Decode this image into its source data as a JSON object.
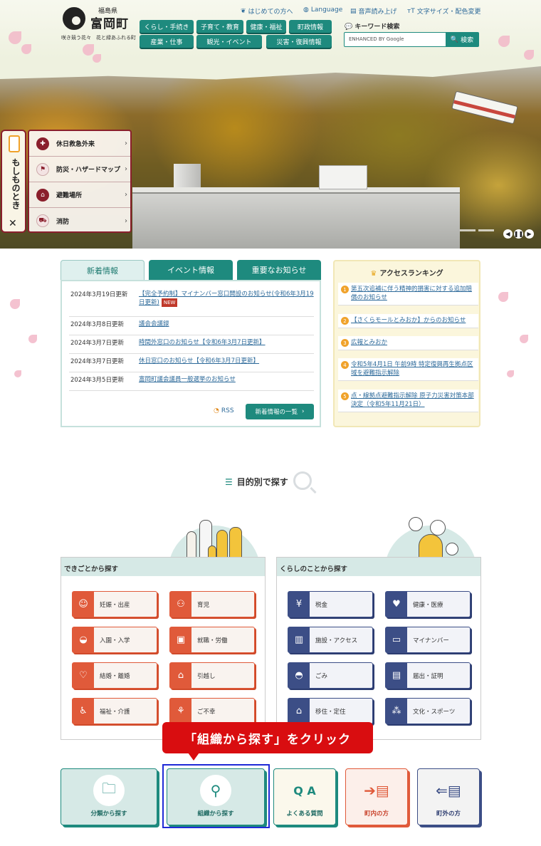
{
  "header": {
    "pref": "福島県",
    "town": "富岡町",
    "tagline": "咲き競う花々　花と緑あふれる町",
    "util": [
      {
        "label": "はじめての方へ",
        "icon": "leaf-icon"
      },
      {
        "label": "Language",
        "icon": "globe-icon"
      },
      {
        "label": "音声読み上げ",
        "icon": "speaker-icon"
      },
      {
        "label": "文字サイズ・配色変更",
        "icon": "text-size-icon"
      }
    ],
    "nav": [
      "くらし・手続き",
      "子育て・教育",
      "健康・福祉",
      "町政情報",
      "産業・仕事",
      "観光・イベント",
      "災害・復興情報"
    ],
    "keyword_label": "キーワード検索",
    "search_placeholder": "ENHANCED BY Google",
    "search_button": "検索"
  },
  "emergency": {
    "tab_label": "もしものとき",
    "close": "✕",
    "items": [
      "休日救急外来",
      "防災・ハザードマップ",
      "避難場所",
      "消防"
    ]
  },
  "news": {
    "tabs": [
      "新着情報",
      "イベント情報",
      "重要なお知らせ"
    ],
    "items": [
      {
        "date": "2024年3月19日更新",
        "text": "【完全予約制】マイナンバー窓口開設のお知らせ(令和6年3月19日更新)",
        "new": "NEW"
      },
      {
        "date": "2024年3月8日更新",
        "text": "議会会議録"
      },
      {
        "date": "2024年3月7日更新",
        "text": "時間外窓口のお知らせ【令和6年3月7日更新】"
      },
      {
        "date": "2024年3月7日更新",
        "text": "休日窓口のお知らせ【令和6年3月7日更新】"
      },
      {
        "date": "2024年3月5日更新",
        "text": "富岡町議会議員一般選挙のお知らせ"
      }
    ],
    "rss": "RSS",
    "more": "新着情報の一覧"
  },
  "ranking": {
    "title": "アクセスランキング",
    "items": [
      {
        "num": "1",
        "text": "第五次追補に伴う精神的損害に対する追加賠償のお知らせ"
      },
      {
        "num": "2",
        "text": "【さくらモールとみおか】からのお知らせ"
      },
      {
        "num": "3",
        "text": "広報とみおか"
      },
      {
        "num": "4",
        "text": "令和5年4月1日 午前9時 特定復興再生拠点区域を避難指示解除"
      },
      {
        "num": "5",
        "text": "点・線拠点避難指示解除 原子力災害対策本部決定（令和5年11月21日）"
      }
    ]
  },
  "purpose": {
    "title": "目的別で探す",
    "life_events": {
      "title": "できごとから探す",
      "items": [
        {
          "label": "妊娠・出産",
          "icon": "pregnancy-icon"
        },
        {
          "label": "育児",
          "icon": "stroller-icon"
        },
        {
          "label": "入園・入学",
          "icon": "school-hat-icon"
        },
        {
          "label": "就職・労働",
          "icon": "briefcase-icon"
        },
        {
          "label": "結婚・離婚",
          "icon": "heart-icon"
        },
        {
          "label": "引越し",
          "icon": "house-icon"
        },
        {
          "label": "福祉・介護",
          "icon": "care-icon"
        },
        {
          "label": "ご不幸",
          "icon": "memorial-icon"
        }
      ]
    },
    "living": {
      "title": "くらしのことから探す",
      "items": [
        {
          "label": "税金",
          "icon": "yen-icon"
        },
        {
          "label": "健康・医療",
          "icon": "heartbeat-icon"
        },
        {
          "label": "施設・アクセス",
          "icon": "train-icon"
        },
        {
          "label": "マイナンバー",
          "icon": "id-card-icon"
        },
        {
          "label": "ごみ",
          "icon": "garbage-bag-icon"
        },
        {
          "label": "届出・証明",
          "icon": "document-icon"
        },
        {
          "label": "移住・定住",
          "icon": "home-heart-icon"
        },
        {
          "label": "文化・スポーツ",
          "icon": "footprints-icon"
        }
      ]
    }
  },
  "callout": "「組織から探す」をクリック",
  "bottom_nav": [
    {
      "label": "分類から探す",
      "icon": "folder-search-icon"
    },
    {
      "label": "組織から探す",
      "icon": "organization-icon"
    },
    {
      "label": "よくある質問",
      "icon": "qa-icon"
    },
    {
      "label": "町内の方",
      "icon": "arrow-in-icon"
    },
    {
      "label": "町外の方",
      "icon": "arrow-out-icon"
    }
  ],
  "colors": {
    "primary": "#1e8a7e",
    "accent_orange": "#e05a3a",
    "accent_navy": "#3c4e86",
    "emergency": "#8a1f2c",
    "callout": "#d90d10",
    "highlight": "#1f2ad6"
  }
}
